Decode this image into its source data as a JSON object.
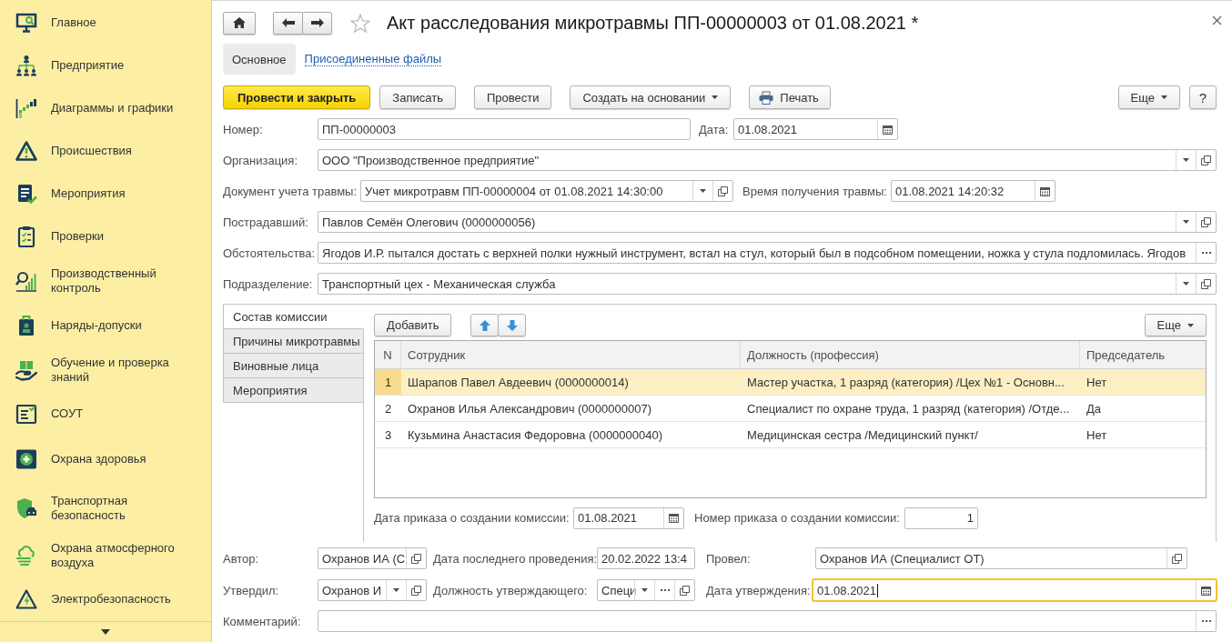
{
  "sidebar": {
    "items": [
      {
        "label": "Главное"
      },
      {
        "label": "Предприятие"
      },
      {
        "label": "Диаграммы и графики"
      },
      {
        "label": "Происшествия"
      },
      {
        "label": "Мероприятия"
      },
      {
        "label": "Проверки"
      },
      {
        "label": "Производственный контроль"
      },
      {
        "label": "Наряды-допуски"
      },
      {
        "label": "Обучение и проверка знаний"
      },
      {
        "label": "СОУТ"
      },
      {
        "label": "Охрана здоровья"
      },
      {
        "label": "Транспортная безопасность"
      },
      {
        "label": "Охрана атмосферного воздуха"
      },
      {
        "label": "Электробезопасность"
      }
    ]
  },
  "window": {
    "title": "Акт расследования микротравмы ПП-00000003 от 01.08.2021 *"
  },
  "form_tabs": [
    {
      "label": "Основное",
      "selected": true
    },
    {
      "label": "Присоединенные файлы",
      "selected": false
    }
  ],
  "toolbar": {
    "buttons": [
      {
        "label": "Провести и закрыть",
        "kind": "default"
      },
      {
        "label": "Записать",
        "kind": "plain"
      },
      {
        "label": "Провести",
        "kind": "plain"
      },
      {
        "label": "Создать на основании",
        "kind": "menu"
      },
      {
        "label": "Печать",
        "kind": "print"
      }
    ],
    "more": "Еще",
    "help": "?"
  },
  "form": {
    "rows": [
      {
        "fields": [
          {
            "label": "Номер:",
            "value": "ПП-00000003",
            "focused": false
          },
          {
            "label": "Дата:",
            "value": "01.08.2021",
            "buttons": [
              {
                "kind": "calendar"
              }
            ],
            "focused": false
          }
        ]
      },
      {
        "fields": [
          {
            "label": "Организация:",
            "value": "ООО \"Производственное предприятие\"",
            "buttons": [
              {
                "kind": "dropdown"
              },
              {
                "kind": "open"
              }
            ],
            "focused": false
          }
        ]
      },
      {
        "fields": [
          {
            "label": "Документ учета травмы:",
            "value": "Учет микротравм ПП-00000004 от 01.08.2021 14:30:00",
            "buttons": [
              {
                "kind": "dropdown"
              },
              {
                "kind": "open"
              }
            ],
            "focused": false
          },
          {
            "label": "Время получения травмы:",
            "value": "01.08.2021 14:20:32",
            "buttons": [
              {
                "kind": "calendar"
              }
            ],
            "focused": false
          }
        ]
      },
      {
        "fields": [
          {
            "label": "Пострадавший:",
            "value": "Павлов Семён Олегович (0000000056)",
            "buttons": [
              {
                "kind": "dropdown"
              },
              {
                "kind": "open"
              }
            ],
            "focused": false
          }
        ]
      },
      {
        "fields": [
          {
            "label": "Обстоятельства:",
            "value": "Ягодов И.Р. пытался достать с верхней полки нужный инструмент, встал на стул, который был в подсобном помещении, ножка у стула подломилась. Ягодов",
            "buttons": [
              {
                "kind": "choice"
              }
            ],
            "focused": false
          }
        ]
      },
      {
        "fields": [
          {
            "label": "Подразделение:",
            "value": "Транспортный цех - Механическая служба",
            "buttons": [
              {
                "kind": "dropdown"
              },
              {
                "kind": "open"
              }
            ],
            "focused": false
          }
        ]
      }
    ]
  },
  "commission": {
    "tabs": [
      {
        "label": "Состав комиссии",
        "selected": true
      },
      {
        "label": "Причины микротравмы",
        "selected": false
      },
      {
        "label": "Виновные лица",
        "selected": false
      },
      {
        "label": "Мероприятия",
        "selected": false
      }
    ],
    "toolbar": {
      "add": "Добавить",
      "more": "Еще"
    },
    "table": {
      "columns": [
        "N",
        "Сотрудник",
        "Должность (профессия)",
        "Председатель"
      ],
      "rows": [
        {
          "cells": [
            "1",
            "Шарапов Павел Авдеевич (0000000014)",
            "Мастер участка, 1 разряд (категория) /Цех №1 - Основн...",
            "Нет"
          ],
          "selected": true
        },
        {
          "cells": [
            "2",
            "Охранов Илья Александрович (0000000007)",
            "Специалист по охране труда, 1 разряд (категория) /Отде...",
            "Да"
          ],
          "selected": false
        },
        {
          "cells": [
            "3",
            "Кузьмина Анастасия Федоровна (0000000040)",
            "Медицинская сестра /Медицинский пункт/",
            "Нет"
          ],
          "selected": false
        }
      ]
    },
    "order_fields": [
      {
        "label": "Дата приказа о создании комиссии:",
        "value": "01.08.2021",
        "buttons": [
          {
            "kind": "calendar"
          }
        ],
        "focused": false
      },
      {
        "label": "Номер приказа о создании комиссии:",
        "value": "1",
        "focused": false
      }
    ]
  },
  "footer": {
    "rows": [
      {
        "fields": [
          {
            "label": "Автор:",
            "value": "Охранов ИА (С",
            "buttons": [
              {
                "kind": "open"
              }
            ],
            "focused": false
          },
          {
            "label": "Дата последнего проведения:",
            "value": "20.02.2022 13:4",
            "focused": false
          },
          {
            "label": "Провел:",
            "value": "Охранов ИА (Специалист ОТ)",
            "buttons": [
              {
                "kind": "open"
              }
            ],
            "focused": false
          }
        ]
      },
      {
        "fields": [
          {
            "label": "Утвердил:",
            "value": "Охранов И",
            "buttons": [
              {
                "kind": "dropdown"
              },
              {
                "kind": "open"
              }
            ],
            "focused": false
          },
          {
            "label": "Должность утверждающего:",
            "value": "Специ",
            "buttons": [
              {
                "kind": "dropdown"
              },
              {
                "kind": "choice"
              },
              {
                "kind": "open"
              }
            ],
            "focused": false
          },
          {
            "label": "Дата утверждения:",
            "value": "01.08.2021",
            "buttons": [
              {
                "kind": "calendar"
              }
            ],
            "focused": true
          }
        ]
      },
      {
        "fields": [
          {
            "label": "Комментарий:",
            "buttons": [
              {
                "kind": "choice"
              }
            ],
            "focused": false
          }
        ]
      }
    ]
  }
}
